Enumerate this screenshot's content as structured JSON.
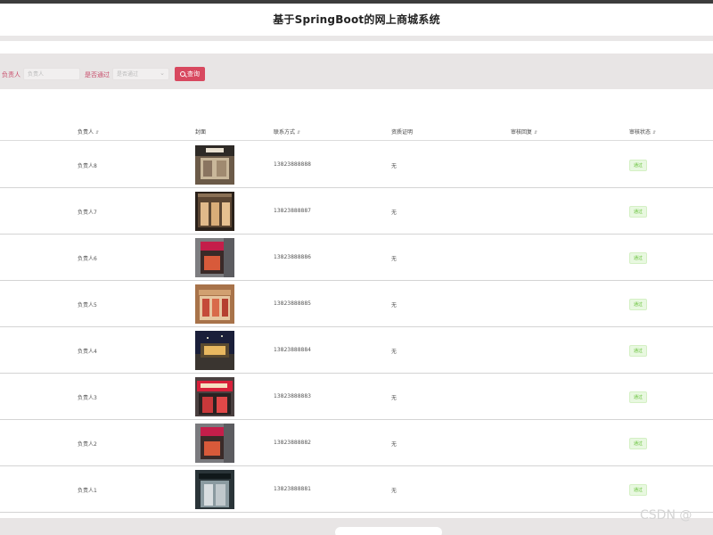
{
  "header": {
    "title": "基于SpringBoot的网上商城系统"
  },
  "search": {
    "label_owner": "负责人",
    "placeholder_owner": "负责人",
    "label_status": "是否通过",
    "placeholder_status": "是否通过",
    "button_label": "查询"
  },
  "table": {
    "columns": [
      "负责人",
      "封面",
      "联系方式",
      "资质证明",
      "审核回复",
      "审核状态"
    ],
    "rows": [
      {
        "owner": "负责人8",
        "phone": "13823888888",
        "qualification": "无",
        "status": "通过"
      },
      {
        "owner": "负责人7",
        "phone": "13823888887",
        "qualification": "无",
        "status": "通过"
      },
      {
        "owner": "负责人6",
        "phone": "13823888886",
        "qualification": "无",
        "status": "通过"
      },
      {
        "owner": "负责人5",
        "phone": "13823888885",
        "qualification": "无",
        "status": "通过"
      },
      {
        "owner": "负责人4",
        "phone": "13823888884",
        "qualification": "无",
        "status": "通过"
      },
      {
        "owner": "负责人3",
        "phone": "13823888883",
        "qualification": "无",
        "status": "通过"
      },
      {
        "owner": "负责人2",
        "phone": "13823888882",
        "qualification": "无",
        "status": "通过"
      },
      {
        "owner": "负责人1",
        "phone": "13823888881",
        "qualification": "无",
        "status": "通过"
      }
    ]
  },
  "footer": {
    "pager_text": ""
  },
  "watermark": "CSDN @",
  "colors": {
    "accent": "#d8485f",
    "status_green": "#67c23a",
    "bar": "#e8e5e5"
  }
}
